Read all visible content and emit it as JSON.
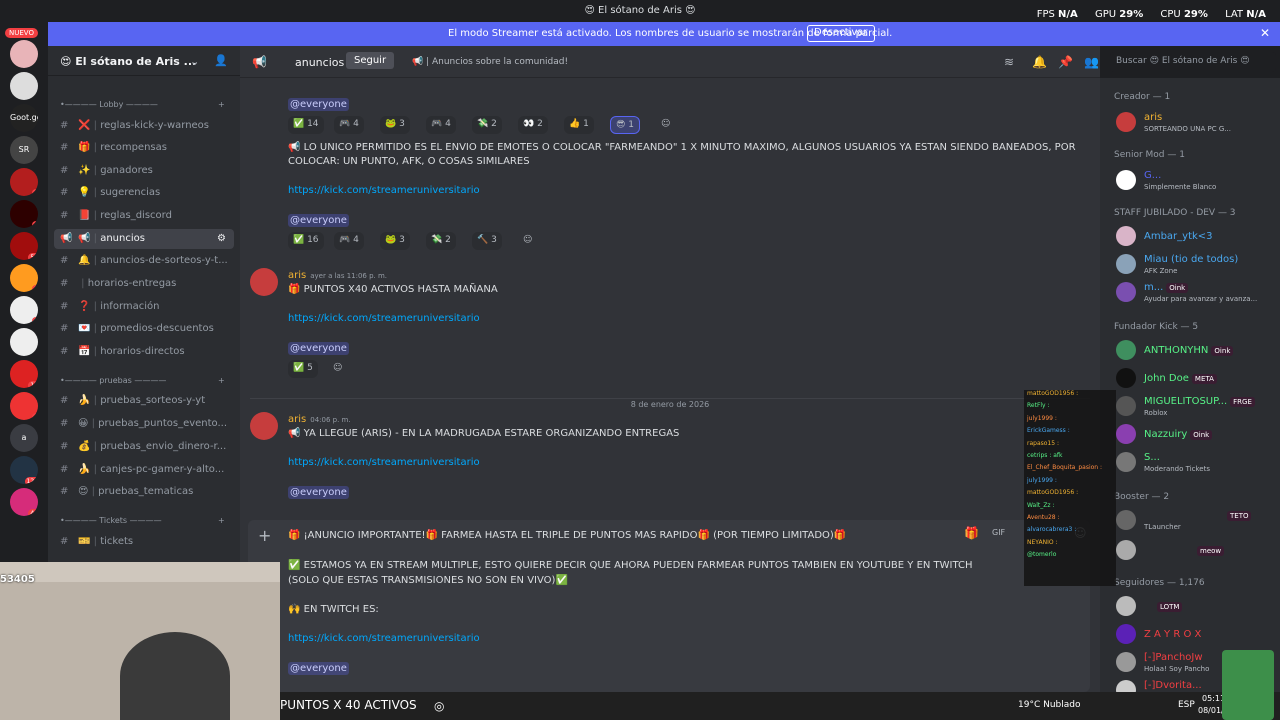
{
  "window": {
    "title": "😍 El sótano de Aris 😍",
    "stats": [
      {
        "label": "FPS",
        "value": "N/A"
      },
      {
        "label": "GPU",
        "value": "29%"
      },
      {
        "label": "CPU",
        "value": "29%"
      },
      {
        "label": "LAT",
        "value": "N/A"
      }
    ]
  },
  "banner": {
    "message": "El modo Streamer está activado. Los nombres de usuario se mostrarán de forma parcial.",
    "button": "Desactivar"
  },
  "servers": {
    "new_label": "NUEVO",
    "items": [
      {
        "label": "",
        "badge": ""
      },
      {
        "label": "",
        "badge": ""
      },
      {
        "label": "Goot.gg",
        "badge": ""
      },
      {
        "label": "SR",
        "badge": ""
      },
      {
        "label": "",
        "badge": "1"
      },
      {
        "label": "",
        "badge": "1"
      },
      {
        "label": "",
        "badge": "55"
      },
      {
        "label": "",
        "badge": "1"
      },
      {
        "label": "",
        "badge": "6"
      },
      {
        "label": "",
        "badge": ""
      },
      {
        "label": "",
        "badge": "13"
      },
      {
        "label": "",
        "badge": "4"
      },
      {
        "label": "a",
        "badge": ""
      },
      {
        "label": "",
        "badge": "129"
      },
      {
        "label": "",
        "badge": "44"
      }
    ]
  },
  "server": {
    "name": "😍 El sótano de Aris ..."
  },
  "categories": {
    "lobby": "Lobby",
    "pruebas": "pruebas",
    "tickets": "Tickets"
  },
  "channels": [
    {
      "emoji": "❌",
      "label": "reglas-kick-y-warneos"
    },
    {
      "emoji": "🎁",
      "label": "recompensas"
    },
    {
      "emoji": "✨",
      "label": "ganadores"
    },
    {
      "emoji": "💡",
      "label": "sugerencias"
    },
    {
      "emoji": "📕",
      "label": "reglas_discord"
    },
    {
      "emoji": "📢",
      "label": "anuncios"
    },
    {
      "emoji": "🔔",
      "label": "anuncios-de-sorteos-y-t..."
    },
    {
      "emoji": "",
      "label": "horarios-entregas"
    },
    {
      "emoji": "❓",
      "label": "información"
    },
    {
      "emoji": "💌",
      "label": "promedios-descuentos"
    },
    {
      "emoji": "📅",
      "label": "horarios-directos"
    },
    {
      "emoji": "🍌",
      "label": "pruebas_sorteos-y-yt"
    },
    {
      "emoji": "😀",
      "label": "pruebas_puntos_evento..."
    },
    {
      "emoji": "💰",
      "label": "pruebas_envio_dinero-r..."
    },
    {
      "emoji": "🍌",
      "label": "canjes-pc-gamer-y-alto..."
    },
    {
      "emoji": "😍",
      "label": "pruebas_tematicas"
    },
    {
      "emoji": "🎫",
      "label": "tickets"
    }
  ],
  "chat_header": {
    "channel": "anuncios",
    "follow": "Seguir",
    "topic": "📢 | Anuncios sobre la comunidad!"
  },
  "messages": {
    "m1": {
      "mention": "@everyone",
      "text": "📢 LO UNICO PERMITIDO ES EL ENVIO DE EMOTES O COLOCAR \"FARMEANDO\" 1 X MINUTO MAXIMO, ALGUNOS USUARIOS YA ESTAN SIENDO BANEADOS, POR",
      "text2": "COLOCAR: UN PUNTO, AFK, O COSAS SIMILARES",
      "link": "https://kick.com/streameruniversitario",
      "mention2": "@everyone"
    },
    "r1": [
      "✅ 14",
      "🎮 4",
      "🐸 3",
      "🎮 4",
      "💸 2",
      "👀 2",
      "👍 1",
      "😎 1"
    ],
    "r2": [
      "✅ 16",
      "🎮 4",
      "🐸 3",
      "💸 2",
      "🔨 3"
    ],
    "m2": {
      "author": "aris",
      "time": "ayer a las 11:06 p. m.",
      "text": "🎁 PUNTOS X40 ACTIVOS HASTA MAÑANA",
      "link": "https://kick.com/streameruniversitario",
      "mention": "@everyone",
      "react": "✅ 5"
    },
    "date": "8 de enero de 2026",
    "m3": {
      "author": "aris",
      "time": "04:06 p. m.",
      "text": "📢 YA LLEGUE (ARIS) - EN LA MADRUGADA ESTARE ORGANIZANDO ENTREGAS",
      "link": "https://kick.com/streameruniversitario",
      "mention": "@everyone"
    }
  },
  "composer": {
    "l1": "🎁 ¡ANUNCIO IMPORTANTE!🎁 FARMEA HASTA EL TRIPLE DE PUNTOS MAS RAPIDO🎁 (POR TIEMPO LIMITADO)🎁",
    "l2": "✅ ESTAMOS YA EN STREAM MULTIPLE, ESTO QUIERE DECIR QUE AHORA PUEDEN FARMEAR PUNTOS TAMBIEN EN YOUTUBE Y EN TWITCH",
    "l3": "(SOLO QUE ESTAS TRANSMISIONES NO SON EN VIVO)✅",
    "l4": "🙌 EN TWITCH ES:",
    "link": "https://kick.com/streameruniversitario",
    "mention": "@everyone"
  },
  "search": {
    "placeholder": "Buscar 😍 El sótano de Aris 😍"
  },
  "members": {
    "cat_creator": "Creador — 1",
    "cat_senior": "Senior Mod — 1",
    "cat_staff": "STAFF JUBILADO - DEV — 3",
    "cat_founder": "Fundador Kick — 5",
    "cat_booster": "Booster — 2",
    "cat_followers": "Seguidores — 1,176",
    "aris": {
      "name": "aris",
      "status": "SORTEANDO UNA PC G..."
    },
    "senior": {
      "name": "G...",
      "status": "Simplemente Blanco"
    },
    "ambar": {
      "name": "Ambar_ytk<3"
    },
    "miau": {
      "name": "Miau (tio de todos)",
      "status": "AFK Zone"
    },
    "m": {
      "name": "m...",
      "tag": "Oink",
      "status": "Ayudar para avanzar y avanza..."
    },
    "anthony": {
      "name": "ANTHONYHN",
      "tag": "Oink"
    },
    "john": {
      "name": "John Doe",
      "tag": "META"
    },
    "miguel": {
      "name": "MIGUELITOSUP...",
      "tag": "FRGE",
      "status": "Roblox"
    },
    "nazz": {
      "name": "Nazzuiry",
      "tag": "Oink"
    },
    "s": {
      "name": "S...",
      "status": "Moderando Tickets"
    },
    "b1": {
      "tag": "TETO",
      "status": "TLauncher"
    },
    "b2": {
      "tag": "meow"
    },
    "f1": {
      "tag": "LOTM"
    },
    "f2": {
      "name": "Z A Y R O X"
    },
    "f3": {
      "name": "[-]PanchoJw",
      "status": "Holaa! Soy Pancho"
    },
    "f4": {
      "name": "[-]Dvorita..."
    }
  },
  "kickchat": [
    "mattoGOD1956 :",
    "RetFly :",
    "july1999 :",
    "ErickGamess :",
    "rapaso15 :",
    "cetrips : afk",
    "El_Chef_Boquita_pasion :",
    "july1999 :",
    "mattoGOD1956 :",
    "Walt_Zz :",
    "Aventu28 :",
    "alvarocabrera3 :",
    "NEYANIO :",
    "@tomerlo"
  ],
  "overlay": {
    "points": "53405",
    "banner_text": "PUNTOS X 40 ACTIVOS"
  },
  "taskbar": {
    "weather": "19°C Nublado",
    "lang": "ESP",
    "time": "05:11",
    "date": "08/01/..."
  }
}
